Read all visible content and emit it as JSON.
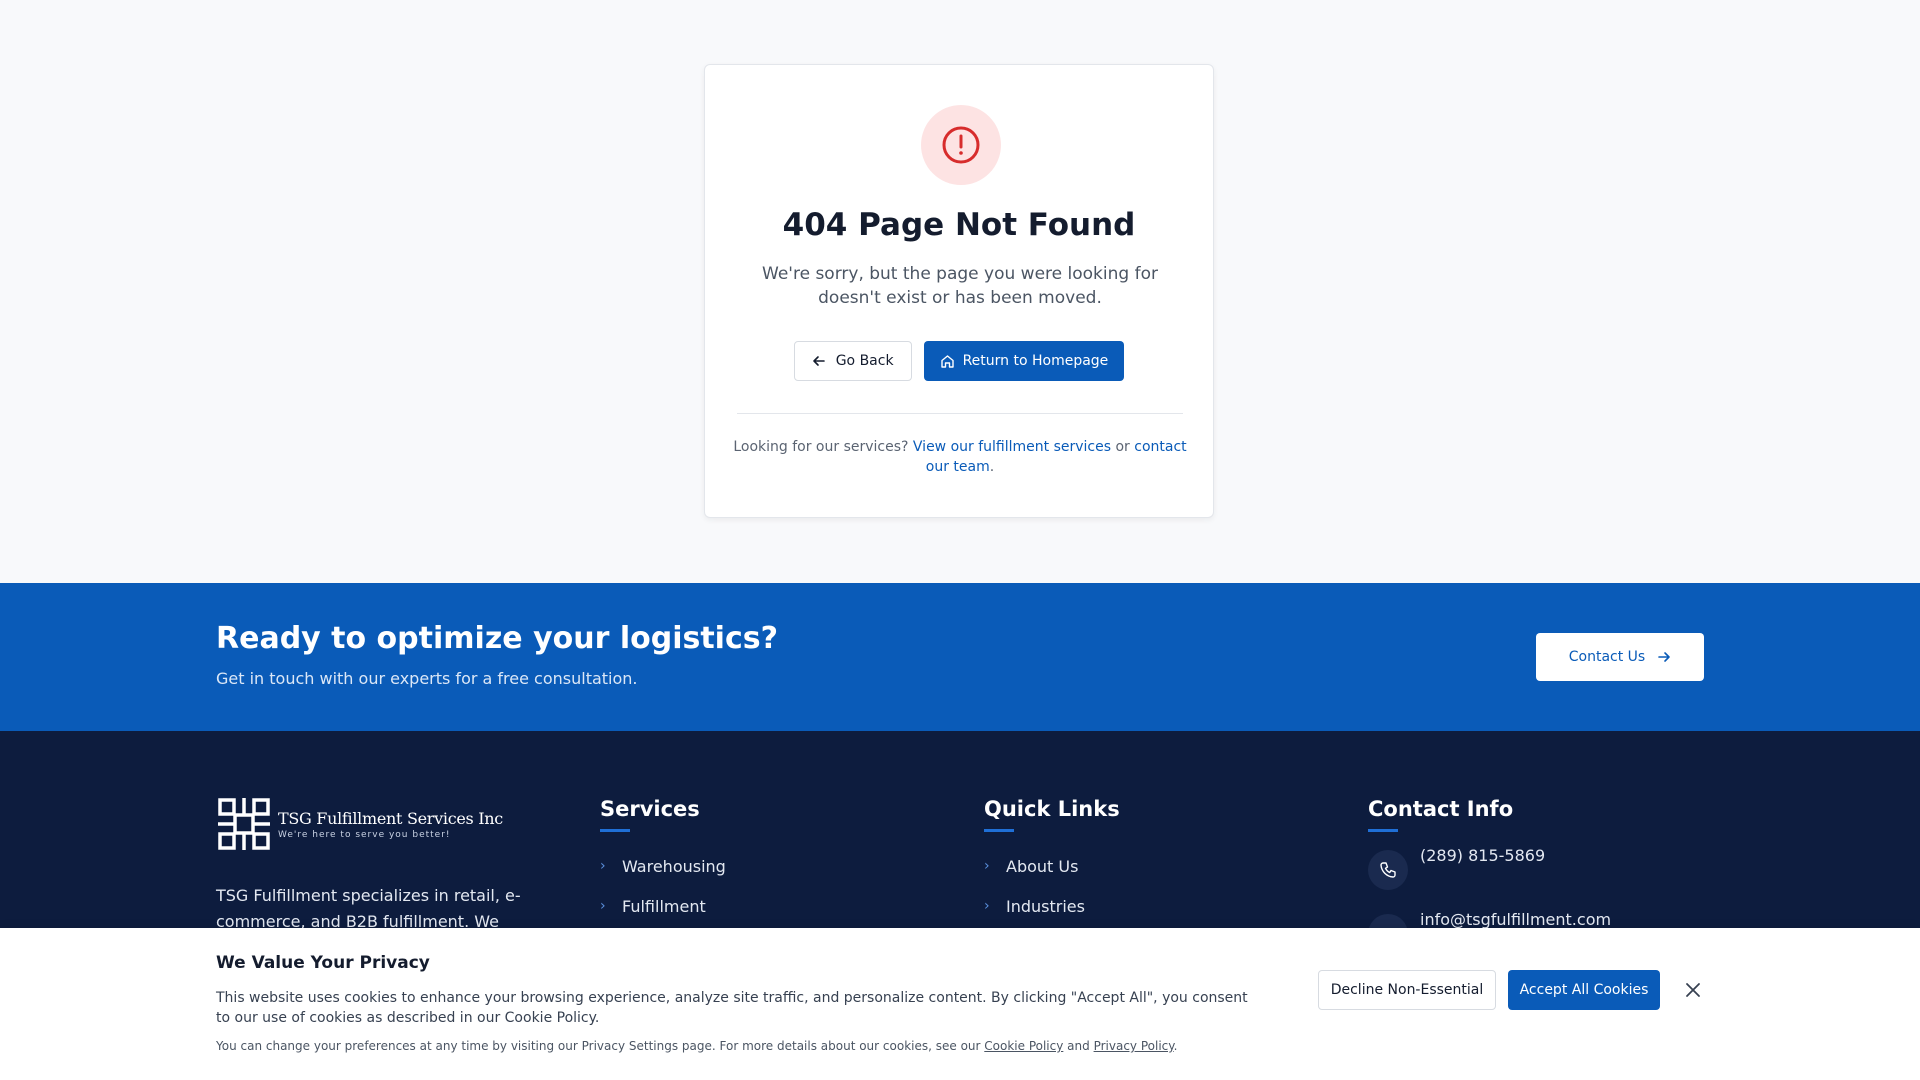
{
  "error": {
    "icon": "alert-circle-icon",
    "title": "404 Page Not Found",
    "message": "We're sorry, but the page you were looking for doesn't exist or has been moved.",
    "back_label": "Go Back",
    "home_label": "Return to Homepage",
    "footer_prefix": "Looking for our services?",
    "footer_link1": "View our fulfillment services",
    "footer_mid": "or",
    "footer_link2": "contact our team",
    "footer_end": "."
  },
  "cta": {
    "title": "Ready to optimize your logistics?",
    "subtitle": "Get in touch with our experts for a free consultation.",
    "button_label": "Contact Us"
  },
  "footer": {
    "logo_name": "TSG Fulfillment Services Inc",
    "logo_tagline": "We're here to serve you better!",
    "about": "TSG Fulfillment specializes in retail, e-commerce, and B2B fulfillment. We provide",
    "services": {
      "title": "Services",
      "items": [
        "Warehousing",
        "Fulfillment"
      ]
    },
    "quick_links": {
      "title": "Quick Links",
      "items": [
        "About Us",
        "Industries"
      ]
    },
    "contact": {
      "title": "Contact Info",
      "phone": "(289) 815-5869",
      "email": "info@tsgfulfillment.com"
    }
  },
  "cookie": {
    "title": "We Value Your Privacy",
    "text": "This website uses cookies to enhance your browsing experience, analyze site traffic, and personalize content. By clicking \"Accept All\", you consent to our use of cookies as described in our Cookie Policy.",
    "small_prefix": "You can change your preferences at any time by visiting our Privacy Settings page. For more details about our cookies, see our",
    "cookie_policy_link": "Cookie Policy",
    "small_and": "and",
    "privacy_policy_link": "Privacy Policy",
    "small_end": ".",
    "decline_label": "Decline Non-Essential",
    "accept_label": "Accept All Cookies"
  },
  "colors": {
    "primary": "#0a5bb8",
    "footer_bg": "#0d1c3e",
    "error_red": "#d72c2c",
    "error_bg": "#fde3e3"
  }
}
